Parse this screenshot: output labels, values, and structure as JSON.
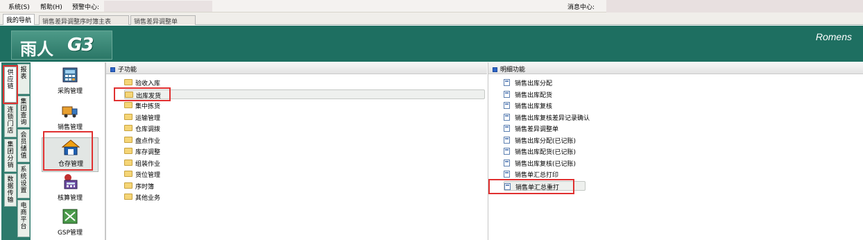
{
  "menu": {
    "system": "系统(S)",
    "help": "帮助(H)",
    "warning_center": "预警中心:",
    "message_center": "消息中心:"
  },
  "tabs": [
    "我的导航",
    "销售差异调整序时簿主表",
    "销售差异调整单"
  ],
  "banner": {
    "logo_cn": "雨人",
    "logo_g3": "G3",
    "brand": "Romens"
  },
  "vtabs": [
    "供应链",
    "连锁门店",
    "集团分销",
    "数据传输",
    "报表",
    "集团查询",
    "会员储值",
    "系统设置",
    "电商平台"
  ],
  "modules": [
    "采购管理",
    "销售管理",
    "仓存管理",
    "核算管理",
    "GSP管理"
  ],
  "sub_panel": {
    "title": "子功能",
    "items": [
      "验收入库",
      "出库发货",
      "集中拣货",
      "运输管理",
      "仓库调拨",
      "盘点作业",
      "库存调整",
      "组装作业",
      "货位管理",
      "序时簿",
      "其他业务"
    ]
  },
  "detail_panel": {
    "title": "明细功能",
    "items": [
      "销售出库分配",
      "销售出库配货",
      "销售出库复核",
      "销售出库复核差异记录确认",
      "销售差异调整单",
      "销售出库分配(已记账)",
      "销售出库配货(已记账)",
      "销售出库复核(已记账)",
      "销售单汇总打印",
      "销售单汇总重打"
    ]
  },
  "colors": {
    "banner": "#1e6f61",
    "highlight_box": "#e03030"
  }
}
